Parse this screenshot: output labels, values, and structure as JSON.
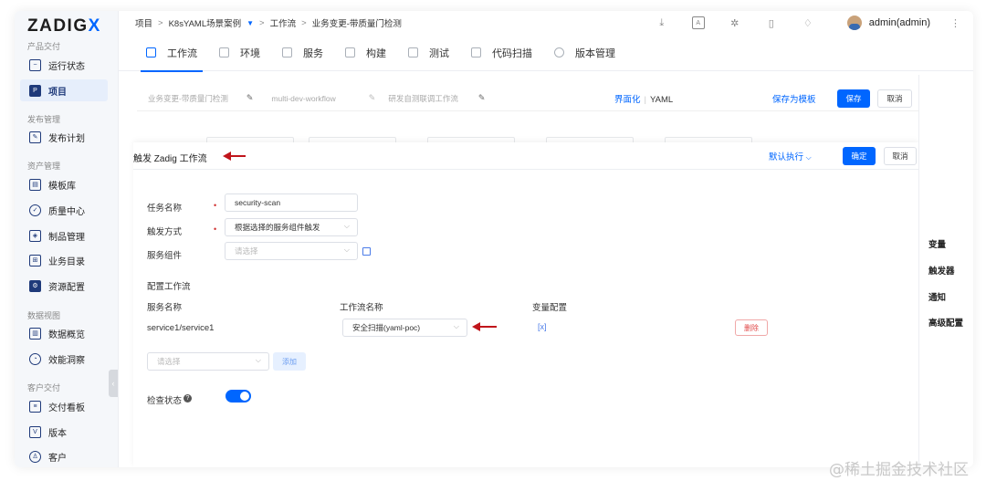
{
  "brand": {
    "logo_main": "ZADIG",
    "logo_x": "X"
  },
  "sidebar": {
    "groups": [
      {
        "title": "产品交付"
      },
      {
        "title": "发布管理"
      },
      {
        "title": "资产管理"
      },
      {
        "title": "数据视图"
      },
      {
        "title": "客户交付"
      }
    ],
    "items": [
      {
        "label": "运行状态",
        "icon": "monitor-icon"
      },
      {
        "label": "项目",
        "icon": "project-icon"
      },
      {
        "label": "发布计划",
        "icon": "release-plan-icon"
      },
      {
        "label": "模板库",
        "icon": "template-icon"
      },
      {
        "label": "质量中心",
        "icon": "quality-icon"
      },
      {
        "label": "制品管理",
        "icon": "artifact-icon"
      },
      {
        "label": "业务目录",
        "icon": "catalog-icon"
      },
      {
        "label": "资源配置",
        "icon": "gear-icon"
      },
      {
        "label": "数据概览",
        "icon": "chart-icon"
      },
      {
        "label": "效能洞察",
        "icon": "pie-icon"
      },
      {
        "label": "交付看板",
        "icon": "board-icon"
      },
      {
        "label": "版本",
        "icon": "version-icon"
      },
      {
        "label": "客户",
        "icon": "customer-icon"
      }
    ],
    "collapse_glyph": "‹"
  },
  "topbar": {
    "breadcrumb": [
      "项目",
      "K8sYAML场景案例",
      "工作流",
      "业务变更-带质量门检测"
    ],
    "sep": ">",
    "user": "admin(admin)"
  },
  "tabs": [
    {
      "label": "工作流",
      "active": true
    },
    {
      "label": "环境"
    },
    {
      "label": "服务"
    },
    {
      "label": "构建"
    },
    {
      "label": "测试"
    },
    {
      "label": "代码扫描"
    },
    {
      "label": "版本管理"
    }
  ],
  "workflow_bar": {
    "names": [
      "业务变更-带质量门检测",
      "multi-dev-workflow",
      "研发自测联调工作流"
    ],
    "mode_gui": "界面化",
    "mode_sep": "|",
    "mode_yaml": "YAML",
    "save_template": "保存为模板",
    "save": "保存",
    "cancel": "取消"
  },
  "drawer": {
    "title": "触发 Zadig 工作流",
    "default_exec": "默认执行",
    "confirm": "确定",
    "cancel": "取消",
    "task_name_label": "任务名称",
    "task_name_value": "security-scan",
    "trigger_mode_label": "触发方式",
    "trigger_mode_value": "根据选择的服务组件触发",
    "service_component_label": "服务组件",
    "service_component_placeholder": "请选择",
    "required_mark": "•",
    "config_section_title": "配置工作流",
    "columns": [
      "服务名称",
      "工作流名称",
      "变量配置"
    ],
    "rows": [
      {
        "service": "service1/service1",
        "workflow": "安全扫描(yaml-poc)",
        "vars": "[x]",
        "delete": "删除"
      }
    ],
    "add_select_placeholder": "请选择",
    "add_button": "添加",
    "check_status_label": "检查状态",
    "check_status_on": true
  },
  "right_pane": {
    "items": [
      "变量",
      "触发器",
      "通知",
      "高级配置"
    ]
  },
  "watermark": "@稀土掘金技术社区",
  "colors": {
    "accent": "#0066ff",
    "annotation_arrow": "#c0151b",
    "danger": "#e04848"
  }
}
